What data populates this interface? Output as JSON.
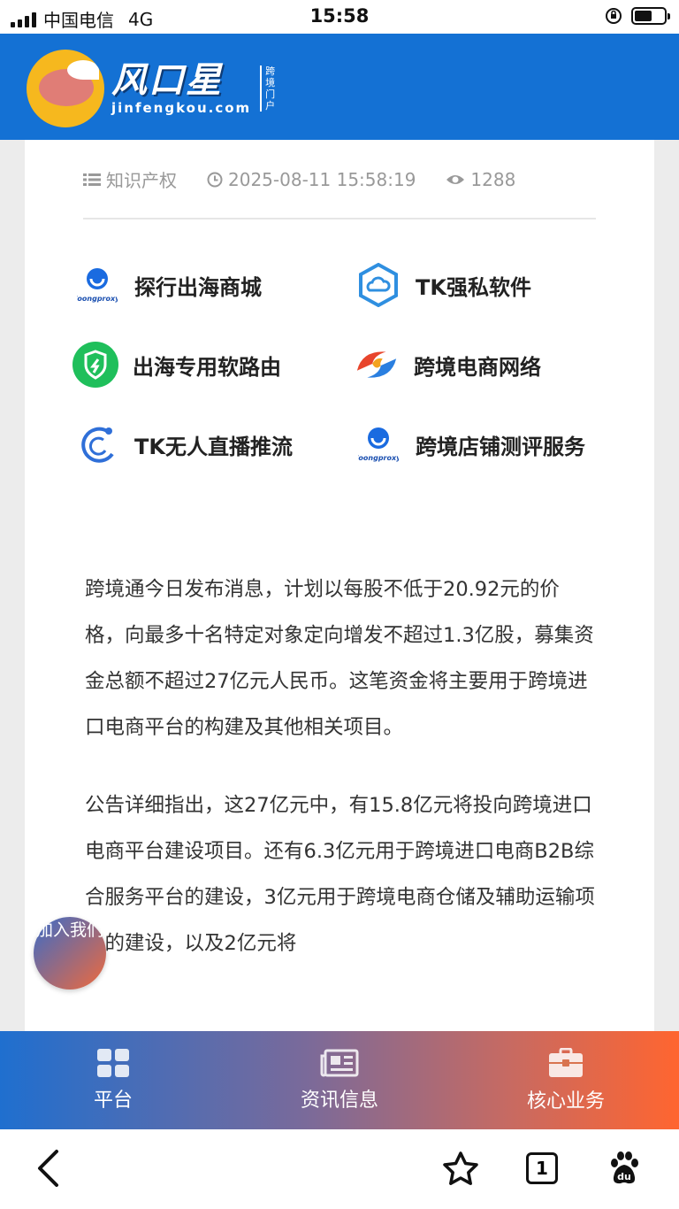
{
  "status_bar": {
    "carrier": "中国电信",
    "network": "4G",
    "time": "15:58",
    "battery_level": 0.6
  },
  "header": {
    "logo_title": "风口星",
    "logo_domain": "jinfengkou.com",
    "logo_tagline": "跨境门户"
  },
  "meta": {
    "category": "知识产权",
    "datetime": "2025-08-11 15:58:19",
    "views": "1288"
  },
  "promos": [
    {
      "label": "探行出海商城",
      "icon": "loongproxy-logo"
    },
    {
      "label": "TK强私软件",
      "icon": "cloud-hexagon-icon"
    },
    {
      "label": "出海专用软路由",
      "icon": "green-shield-icon"
    },
    {
      "label": "跨境电商网络",
      "icon": "swirl-logo"
    },
    {
      "label": "TK无人直播推流",
      "icon": "crescent-logo"
    },
    {
      "label": "跨境店铺测评服务",
      "icon": "loongproxy-logo"
    }
  ],
  "article": {
    "paragraphs": [
      "跨境通今日发布消息，计划以每股不低于20.92元的价格，向最多十名特定对象定向增发不超过1.3亿股，募集资金总额不超过27亿元人民币。这笔资金将主要用于跨境进口电商平台的构建及其他相关项目。",
      "公告详细指出，这27亿元中，有15.8亿元将投向跨境进口电商平台建设项目。还有6.3亿元用于跨境进口电商B2B综合服务平台的建设，3亿元用于跨境电商仓储及辅助运输项目的建设，以及2亿元将"
    ]
  },
  "join_button": {
    "label": "加入我们"
  },
  "tabbar": {
    "items": [
      "平台",
      "资讯信息",
      "核心业务"
    ]
  },
  "browser": {
    "tab_count": "1"
  },
  "colors": {
    "header_blue": "#1471d4",
    "tab_gradient_start": "#1f6fcf",
    "tab_gradient_end": "#ff6530"
  }
}
